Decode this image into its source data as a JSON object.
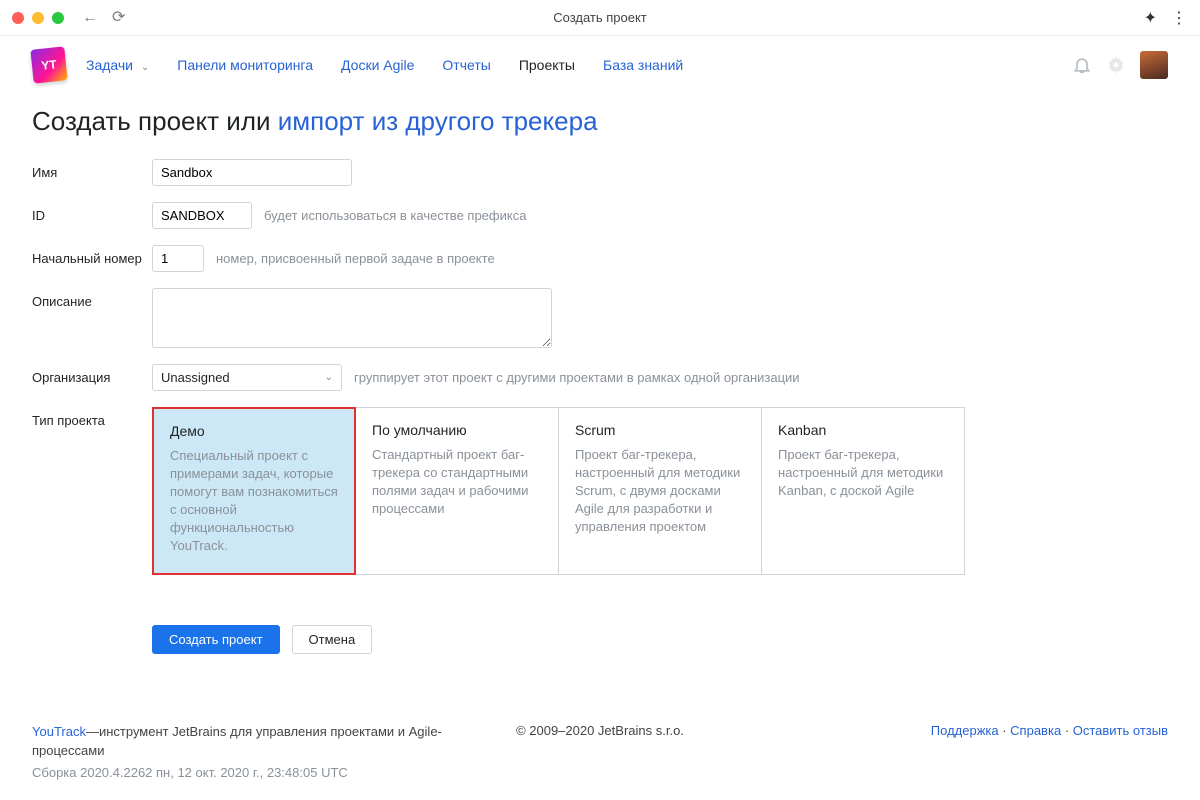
{
  "window": {
    "title": "Создать проект"
  },
  "nav": {
    "items": [
      {
        "label": "Задачи",
        "dropdown": true
      },
      {
        "label": "Панели мониторинга"
      },
      {
        "label": "Доски Agile"
      },
      {
        "label": "Отчеты"
      },
      {
        "label": "Проекты",
        "active": true
      },
      {
        "label": "База знаний"
      }
    ]
  },
  "heading": {
    "prefix": "Создать проект или ",
    "link": "импорт из другого трекера"
  },
  "form": {
    "name": {
      "label": "Имя",
      "value": "Sandbox"
    },
    "id": {
      "label": "ID",
      "value": "SANDBOX",
      "hint": "будет использоваться в качестве префикса"
    },
    "start": {
      "label": "Начальный номер",
      "value": "1",
      "hint": "номер, присвоенный первой задаче в проекте"
    },
    "desc": {
      "label": "Описание",
      "value": ""
    },
    "org": {
      "label": "Организация",
      "value": "Unassigned",
      "hint": "группирует этот проект с другими проектами в рамках одной организации"
    },
    "type": {
      "label": "Тип проекта"
    }
  },
  "projectTypes": [
    {
      "title": "Демо",
      "desc": "Специальный проект с примерами задач, которые помогут вам познакомиться с основной функциональностью YouTrack.",
      "selected": true
    },
    {
      "title": "По умолчанию",
      "desc": "Стандартный проект баг-трекера со стандартными полями задач и рабочими процессами"
    },
    {
      "title": "Scrum",
      "desc": "Проект баг-трекера, настроенный для методики Scrum, с двумя досками Agile для разработки и управления проектом"
    },
    {
      "title": "Kanban",
      "desc": "Проект баг-трекера, настроенный для методики Kanban, с доской Agile"
    }
  ],
  "actions": {
    "submit": "Создать проект",
    "cancel": "Отмена"
  },
  "footer": {
    "product": "YouTrack",
    "tagline": "—инструмент JetBrains для управления проектами и Agile-процессами",
    "build": "Сборка 2020.4.2262 пн, 12 окт. 2020 г., 23:48:05 UTC",
    "copyright": "© 2009–2020 JetBrains s.r.o.",
    "links": {
      "support": "Поддержка",
      "help": "Справка",
      "feedback": "Оставить отзыв"
    }
  }
}
